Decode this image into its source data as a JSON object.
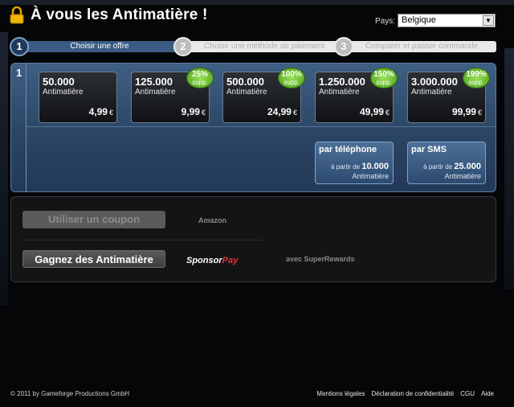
{
  "header": {
    "title": "À vous les Antimatière !",
    "country_label": "Pays:",
    "country_value": "Belgique"
  },
  "steps": [
    {
      "num": "1",
      "label": "Choisir une offre"
    },
    {
      "num": "2",
      "label": "Choisir une méthode de paiement"
    },
    {
      "num": "3",
      "label": "Comparer et passer commande"
    }
  ],
  "offers_panel": {
    "step_num": "1",
    "offers": [
      {
        "amount": "50.000",
        "unit": "Antimatière",
        "price": "4,99",
        "currency": "€"
      },
      {
        "amount": "125.000",
        "unit": "Antimatière",
        "price": "9,99",
        "currency": "€",
        "bonus": "25%",
        "bonus_label": "supp."
      },
      {
        "amount": "500.000",
        "unit": "Antimatière",
        "price": "24,99",
        "currency": "€",
        "bonus": "100%",
        "bonus_label": "supp."
      },
      {
        "amount": "1.250.000",
        "unit": "Antimatière",
        "price": "49,99",
        "currency": "€",
        "bonus": "150%",
        "bonus_label": "supp."
      },
      {
        "amount": "3.000.000",
        "unit": "Antimatière",
        "price": "99,99",
        "currency": "€",
        "bonus": "199%",
        "bonus_label": "supp."
      }
    ],
    "payment_options": [
      {
        "title": "par téléphone",
        "from_label": "à partir de",
        "from_value": "10.000",
        "unit": "Antimatière"
      },
      {
        "title": "par SMS",
        "from_label": "à partir de",
        "from_value": "25.000",
        "unit": "Antimatière"
      }
    ]
  },
  "other_options": {
    "coupon_button": "Utiliser un coupon",
    "amazon": "Amazon",
    "earn_button": "Gagnez des Antimatière",
    "sponsorpay_a": "Sponsor",
    "sponsorpay_b": "Pay",
    "superrewards": "avec SuperRewards"
  },
  "footer": {
    "copyright": "© 2011 by Gameforge Productions GmbH",
    "links": [
      "Mentions légales",
      "Déclaration de confidentialité",
      "CGU",
      "Aide"
    ]
  },
  "colors": {
    "accent_blue": "#3a5c84",
    "badge_green": "#6cc43a",
    "background": "#050608"
  }
}
